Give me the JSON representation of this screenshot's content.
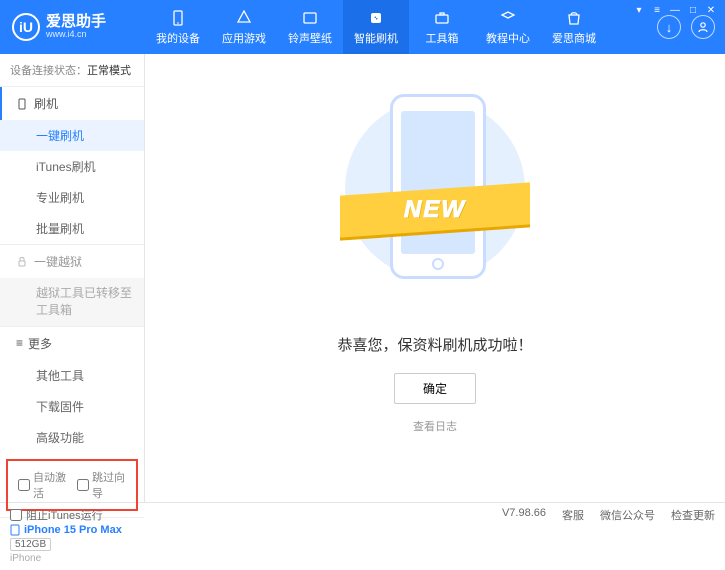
{
  "brand": {
    "name": "爱思助手",
    "url": "www.i4.cn",
    "logo": "iU"
  },
  "nav": [
    {
      "label": "我的设备"
    },
    {
      "label": "应用游戏"
    },
    {
      "label": "铃声壁纸"
    },
    {
      "label": "智能刷机"
    },
    {
      "label": "工具箱"
    },
    {
      "label": "教程中心"
    },
    {
      "label": "爱思商城"
    }
  ],
  "conn": {
    "prefix": "设备连接状态：",
    "value": "正常模式"
  },
  "sidebar": {
    "flash": {
      "title": "刷机",
      "items": [
        "一键刷机",
        "iTunes刷机",
        "专业刷机",
        "批量刷机"
      ]
    },
    "jailbreak": {
      "title": "一键越狱",
      "moved": "越狱工具已转移至工具箱"
    },
    "more": {
      "title": "更多",
      "items": [
        "其他工具",
        "下载固件",
        "高级功能"
      ]
    },
    "checks": {
      "auto_activate": "自动激活",
      "skip_guide": "跳过向导"
    },
    "device": {
      "name": "iPhone 15 Pro Max",
      "storage": "512GB",
      "type": "iPhone"
    }
  },
  "main": {
    "ribbon": "NEW",
    "success": "恭喜您，保资料刷机成功啦！",
    "ok": "确定",
    "log": "查看日志"
  },
  "footer": {
    "block_itunes": "阻止iTunes运行",
    "version": "V7.98.66",
    "links": [
      "客服",
      "微信公众号",
      "检查更新"
    ]
  }
}
